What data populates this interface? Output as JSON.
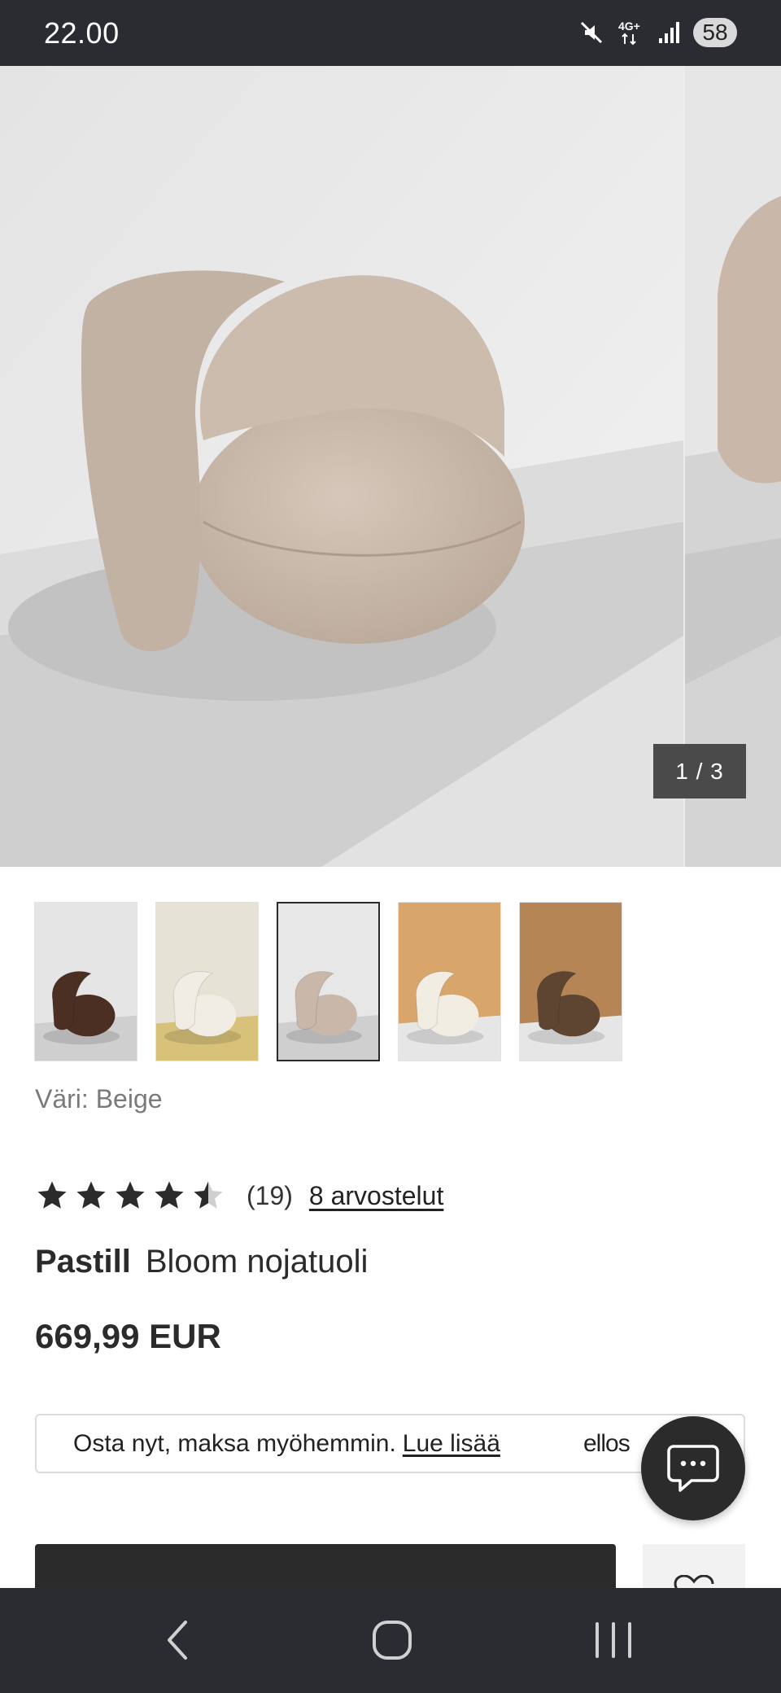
{
  "status_bar": {
    "time": "22.00",
    "network": "4G+",
    "battery": "58",
    "icons": [
      "mute-icon",
      "network-4g-icon",
      "signal-icon",
      "battery-icon"
    ]
  },
  "gallery": {
    "counter": "1 / 3",
    "current_index": 1,
    "total": 3
  },
  "thumbnails": [
    {
      "name": "brown",
      "bg": "#e5e5e5",
      "floor": "#cfcfcf",
      "chair": "#4a2f22",
      "selected": false
    },
    {
      "name": "cream-yellow",
      "bg": "#e6e2d6",
      "floor": "#d8c27a",
      "chair": "#f1ede4",
      "selected": false
    },
    {
      "name": "beige",
      "bg": "#e7e7e7",
      "floor": "#cfcfcf",
      "chair": "#c9b8aa",
      "selected": true
    },
    {
      "name": "cream-orange",
      "bg": "#d8a56a",
      "floor": "#e6e6e6",
      "chair": "#f2ede3",
      "selected": false
    },
    {
      "name": "brown-orange",
      "bg": "#b68556",
      "floor": "#e6e6e6",
      "chair": "#5d4532",
      "selected": false
    }
  ],
  "product": {
    "color_label": "Väri: Beige",
    "rating": 4.5,
    "rating_max": 5,
    "rating_count": "(19)",
    "reviews_link": "8 arvostelut",
    "brand": "Pastill",
    "name": "Bloom nojatuoli",
    "price": "669,99 EUR"
  },
  "klarna_banner": {
    "text": "Osta nyt, maksa myöhemmin.",
    "link": "Lue lisää",
    "logo": "ellos"
  },
  "actions": {
    "buy_label": "",
    "favorite_icon": "heart-icon",
    "chat_icon": "chat-bubble-icon"
  },
  "nav_bar": {
    "buttons": [
      "back-icon",
      "home-icon",
      "recents-icon"
    ]
  },
  "colors": {
    "system_bar": "#2b2c31",
    "primary_dark": "#2b2b2b",
    "product_chair": "#c9b8aa"
  }
}
